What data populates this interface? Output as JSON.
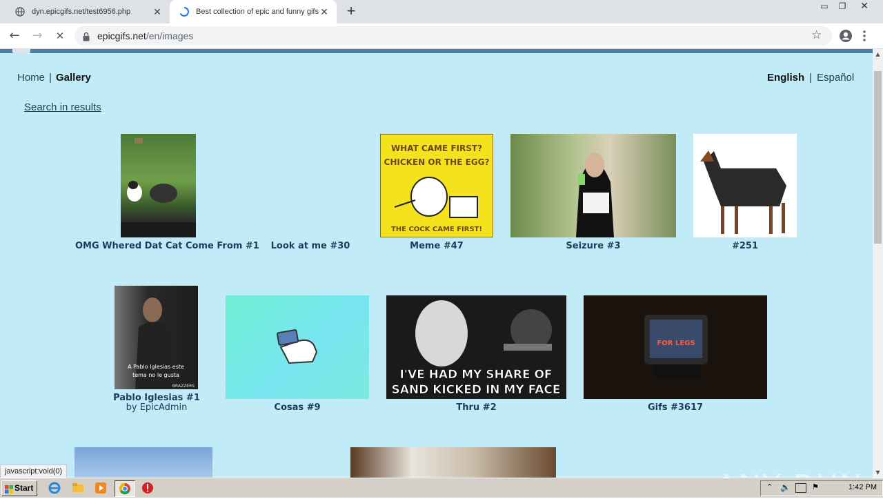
{
  "browser": {
    "tabs": [
      {
        "title": "dyn.epicgifs.net/test6956.php",
        "active": false
      },
      {
        "title": "Best collection of epic and funny gifs",
        "active": true
      }
    ],
    "url_host": "epicgifs.net",
    "url_path": "/en/images"
  },
  "page": {
    "nav": {
      "home": "Home",
      "separator": "|",
      "gallery": "Gallery"
    },
    "lang": {
      "english": "English",
      "separator": "|",
      "spanish": "Español"
    },
    "search_link": "Search in results",
    "gallery": [
      {
        "caption": "OMG Whered Dat Cat Come From #1"
      },
      {
        "caption": "Look at me #30"
      },
      {
        "caption": "Meme #47",
        "image_text_top": "WHAT CAME FIRST? CHICKEN OR THE EGG?",
        "image_text_bottom": "THE COCK CAME FIRST!"
      },
      {
        "caption": "Seizure #3"
      },
      {
        "caption": "#251"
      },
      {
        "caption": "Pablo Iglesias #1",
        "byline": "by EpicAdmin",
        "image_text": "A Pablo Iglesias este tema no le gusta",
        "image_brand": "BRAZZERS"
      },
      {
        "caption": "Cosas #9"
      },
      {
        "caption": "Thru #2",
        "image_text": "I'VE HAD MY SHARE OF SAND KICKED IN MY FACE"
      },
      {
        "caption": "Gifs #3617",
        "image_text": "FOR LEGS"
      }
    ]
  },
  "status_text": "javascript:void(0)",
  "watermark": "ANY RUN",
  "taskbar": {
    "start_label": "Start",
    "clock": "1:42 PM"
  },
  "colors": {
    "page_bg": "#c1ecf7",
    "link": "#1f3a56",
    "caption": "#1a3d5c",
    "header_bar": "#4d7da0"
  }
}
